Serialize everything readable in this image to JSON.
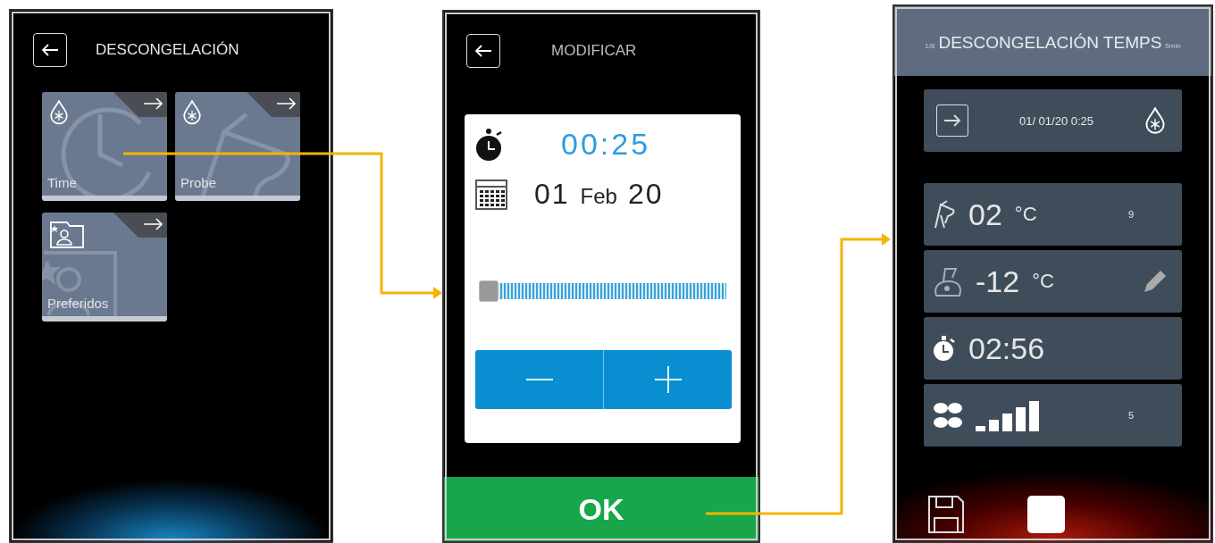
{
  "menu_screen": {
    "title": "DESCONGELACIÓN",
    "tiles": [
      {
        "kind": "time",
        "label": "Time"
      },
      {
        "kind": "probe",
        "label": "Probe"
      },
      {
        "kind": "favorites",
        "label": "Preferidos"
      }
    ]
  },
  "modify_screen": {
    "title": "MODIFICAR",
    "time": "00:25",
    "date": {
      "day": "01",
      "month": "Feb",
      "year": "20"
    },
    "slider": {
      "level": 0
    },
    "ok": "OK"
  },
  "cycle_screen": {
    "header": {
      "step": "1/8",
      "title": "DESCONGELACIÓN TEMPS",
      "duration": "5min"
    },
    "start": "01/ 01/20  0:25",
    "rows": [
      {
        "kind": "probe",
        "value": "02",
        "unit": "°C",
        "aside": "9"
      },
      {
        "kind": "chamber",
        "value": "-12",
        "unit": "°C"
      },
      {
        "kind": "timer",
        "value": "02:56"
      },
      {
        "kind": "fan",
        "value": "5"
      }
    ]
  }
}
